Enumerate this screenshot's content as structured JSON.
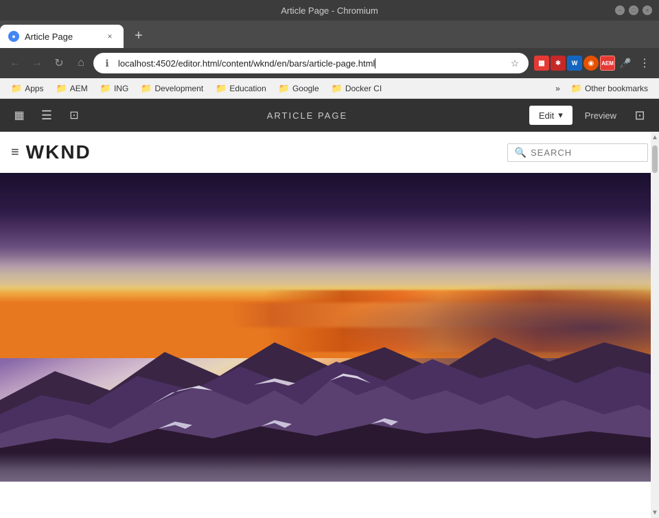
{
  "window": {
    "title": "Article Page - Chromium",
    "controls": [
      "minimize",
      "maximize",
      "close"
    ]
  },
  "tab": {
    "favicon": "●",
    "title": "Article Page",
    "close": "×"
  },
  "nav": {
    "back": "←",
    "forward": "→",
    "reload": "↻",
    "home": "⌂",
    "url": "localhost:4502/editor.html/content/wknd/en/bars/article-page.html",
    "star": "☆",
    "more": "⋮"
  },
  "bookmarks": [
    {
      "id": "apps",
      "label": "Apps",
      "type": "folder"
    },
    {
      "id": "aem",
      "label": "AEM",
      "type": "folder"
    },
    {
      "id": "ing",
      "label": "ING",
      "type": "folder"
    },
    {
      "id": "development",
      "label": "Development",
      "type": "folder"
    },
    {
      "id": "education",
      "label": "Education",
      "type": "folder"
    },
    {
      "id": "google",
      "label": "Google",
      "type": "folder"
    },
    {
      "id": "docker-ci",
      "label": "Docker CI",
      "type": "folder"
    }
  ],
  "bookmarks_more": "»",
  "bookmarks_other": "Other bookmarks",
  "aem_toolbar": {
    "panel_toggle": "▦",
    "properties": "☰",
    "info": "⊡",
    "title": "ARTICLE PAGE",
    "edit_label": "Edit",
    "edit_chevron": "▾",
    "preview_label": "Preview",
    "share_icon": "⊡"
  },
  "wknd": {
    "menu_icon": "≡",
    "logo": "WKND",
    "search_placeholder": "SEARCH",
    "search_icon": "⌕"
  },
  "hero": {
    "alt": "Mountain landscape at sunset"
  }
}
